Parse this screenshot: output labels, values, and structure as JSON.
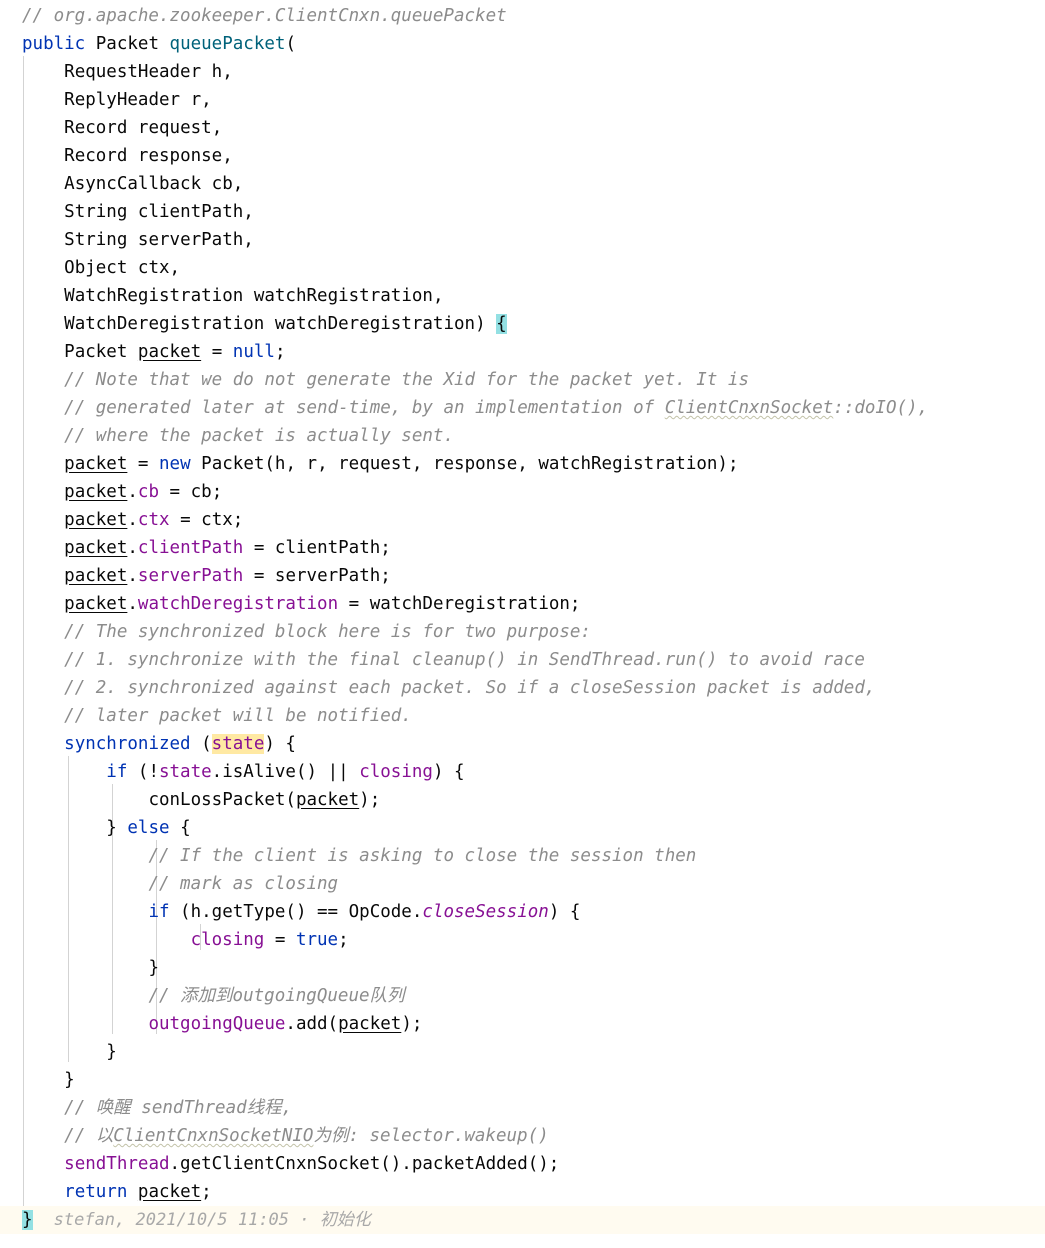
{
  "editor": {
    "language": "java",
    "background": "#ffffff",
    "caret_line_background": "#fffbf0",
    "indent_guide_color": "#d3d3d3",
    "colors": {
      "keyword": "#0033b3",
      "comment": "#8c8c8c",
      "field": "#871094",
      "method_declaration": "#00627a",
      "text": "#080808",
      "brace_match_highlight": "#93e0e3",
      "search_highlight": "#ffe9a3"
    }
  },
  "code": {
    "header_comment": "// org.apache.zookeeper.ClientCnxn.queuePacket",
    "signature": {
      "modifier": "public",
      "return_type": "Packet",
      "name": "queuePacket",
      "open_paren": "(",
      "parameters": [
        {
          "type": "RequestHeader",
          "name": "h",
          "sep": ","
        },
        {
          "type": "ReplyHeader",
          "name": "r",
          "sep": ","
        },
        {
          "type": "Record",
          "name": "request",
          "sep": ","
        },
        {
          "type": "Record",
          "name": "response",
          "sep": ","
        },
        {
          "type": "AsyncCallback",
          "name": "cb",
          "sep": ","
        },
        {
          "type": "String",
          "name": "clientPath",
          "sep": ","
        },
        {
          "type": "String",
          "name": "serverPath",
          "sep": ","
        },
        {
          "type": "Object",
          "name": "ctx",
          "sep": ","
        },
        {
          "type": "WatchRegistration",
          "name": "watchRegistration",
          "sep": ","
        },
        {
          "type": "WatchDeregistration",
          "name": "watchDeregistration",
          "sep": ")"
        }
      ],
      "open_brace": "{"
    },
    "decl": {
      "type": "Packet",
      "var": "packet",
      "eq": "=",
      "value": "null",
      "semi": ";"
    },
    "comments": {
      "note1": "// Note that we do not generate the Xid for the packet yet. It is",
      "note2_a": "// generated later at send-time, by an implementation of ",
      "note2_typo": "ClientCnxnSocket",
      "note2_b": "::doIO(),",
      "note3": "// where the packet is actually sent.",
      "sync1": "// The synchronized block here is for two purpose:",
      "sync2": "// 1. synchronize with the final cleanup() in SendThread.run() to avoid race",
      "sync3": "// 2. synchronized against each packet. So if a closeSession packet is added,",
      "sync4": "// later packet will be notified.",
      "close1": "// If the client is asking to close the session then",
      "close2": "// mark as closing",
      "queue_cn": "// 添加到outgoingQueue队列",
      "wake_cn": "// 唤醒 sendThread线程,",
      "wake_cn2_a": "// 以",
      "wake_cn2_typo": "ClientCnxnSocketNIO",
      "wake_cn2_b": "为例: selector.wakeup()"
    },
    "assignments": {
      "new_packet": {
        "var": "packet",
        "eq": "=",
        "kw_new": "new",
        "ctor": "Packet(h, r, request, response, watchRegistration);"
      },
      "rows": [
        {
          "var": "packet",
          "dot": ".",
          "field": "cb",
          "eq": "=",
          "value": "cb;"
        },
        {
          "var": "packet",
          "dot": ".",
          "field": "ctx",
          "eq": "=",
          "value": "ctx;"
        },
        {
          "var": "packet",
          "dot": ".",
          "field": "clientPath",
          "eq": "=",
          "value": "clientPath;"
        },
        {
          "var": "packet",
          "dot": ".",
          "field": "serverPath",
          "eq": "=",
          "value": "serverPath;"
        },
        {
          "var": "packet",
          "dot": ".",
          "field": "watchDeregistration",
          "eq": "=",
          "value": "watchDeregistration;"
        }
      ]
    },
    "sync_block": {
      "keyword": "synchronized",
      "open": " (",
      "lock": "state",
      "close": ") {"
    },
    "if_alive": {
      "kw": "if",
      "pre": " (!",
      "field1": "state",
      "mid": ".isAlive() || ",
      "field2": "closing",
      "post": ") {"
    },
    "con_loss": {
      "call": "conLossPacket(",
      "arg": "packet",
      "tail": ");"
    },
    "else_line": {
      "close_brace": "} ",
      "kw": "else",
      "open_brace": " {"
    },
    "if_optype": {
      "kw": "if",
      "pre": " (h.getType() == OpCode.",
      "static_field": "closeSession",
      "post": ") {"
    },
    "closing_true": {
      "field": "closing",
      "eq": " = ",
      "kw": "true",
      "semi": ";"
    },
    "queue_add": {
      "field": "outgoingQueue",
      "call": ".add(",
      "arg": "packet",
      "tail": ");"
    },
    "send_thread": {
      "field": "sendThread",
      "call": ".getClientCnxnSocket().packetAdded();"
    },
    "return_line": {
      "kw": "return",
      "var": "packet",
      "semi": ";"
    },
    "closers": {
      "inner_if": "}",
      "else_end": "}",
      "sync_end": "}",
      "method_end": "}"
    }
  },
  "blame": {
    "author": "stefan",
    "date": "2021/10/5 11:05",
    "separator": "·",
    "message": "初始化",
    "text": "stefan, 2021/10/5 11:05 · 初始化"
  }
}
